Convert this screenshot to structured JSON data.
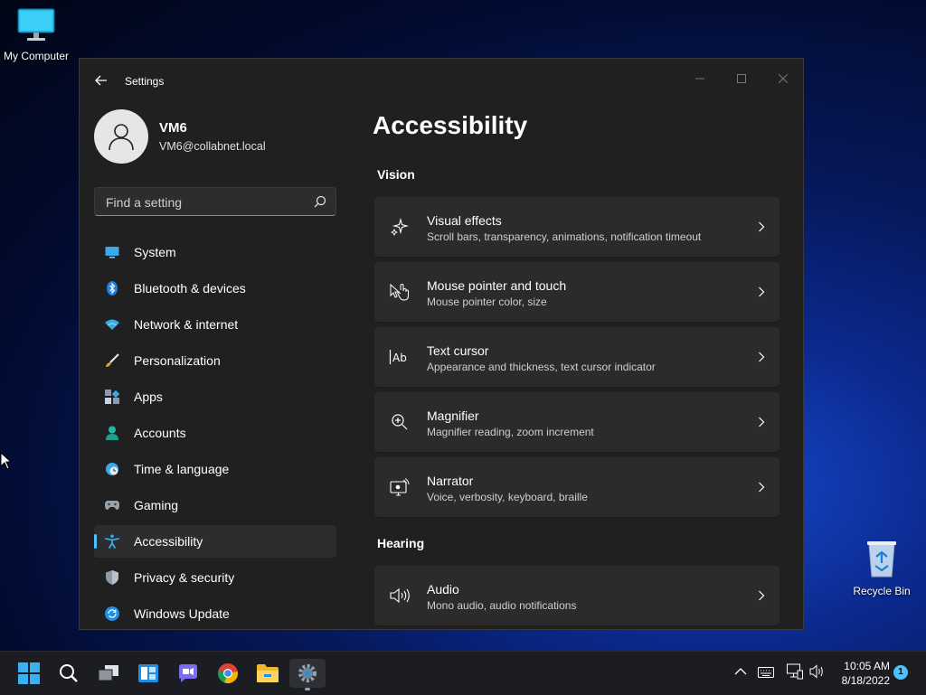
{
  "desktop": {
    "icons": [
      {
        "label": "My Computer"
      },
      {
        "label": "Recycle Bin"
      }
    ]
  },
  "window": {
    "title": "Settings",
    "profile": {
      "name": "VM6",
      "email": "VM6@collabnet.local"
    },
    "search": {
      "placeholder": "Find a setting"
    },
    "nav": [
      {
        "label": "System",
        "icon": "monitor-icon"
      },
      {
        "label": "Bluetooth & devices",
        "icon": "bluetooth-icon"
      },
      {
        "label": "Network & internet",
        "icon": "wifi-icon"
      },
      {
        "label": "Personalization",
        "icon": "brush-icon"
      },
      {
        "label": "Apps",
        "icon": "apps-icon"
      },
      {
        "label": "Accounts",
        "icon": "person-icon"
      },
      {
        "label": "Time & language",
        "icon": "globe-clock-icon"
      },
      {
        "label": "Gaming",
        "icon": "gamepad-icon"
      },
      {
        "label": "Accessibility",
        "icon": "accessibility-icon"
      },
      {
        "label": "Privacy & security",
        "icon": "shield-icon"
      },
      {
        "label": "Windows Update",
        "icon": "update-icon"
      }
    ],
    "active_nav": "Accessibility",
    "page_title": "Accessibility",
    "sections": [
      {
        "title": "Vision",
        "items": [
          {
            "title": "Visual effects",
            "subtitle": "Scroll bars, transparency, animations, notification timeout",
            "icon": "sparkle-icon"
          },
          {
            "title": "Mouse pointer and touch",
            "subtitle": "Mouse pointer color, size",
            "icon": "pointer-touch-icon"
          },
          {
            "title": "Text cursor",
            "subtitle": "Appearance and thickness, text cursor indicator",
            "icon": "text-cursor-icon"
          },
          {
            "title": "Magnifier",
            "subtitle": "Magnifier reading, zoom increment",
            "icon": "magnifier-icon"
          },
          {
            "title": "Narrator",
            "subtitle": "Voice, verbosity, keyboard, braille",
            "icon": "narrator-icon"
          }
        ]
      },
      {
        "title": "Hearing",
        "items": [
          {
            "title": "Audio",
            "subtitle": "Mono audio, audio notifications",
            "icon": "speaker-icon"
          }
        ]
      }
    ]
  },
  "taskbar": {
    "clock": {
      "time": "10:05 AM",
      "date": "8/18/2022"
    },
    "notification_count": "1"
  },
  "colors": {
    "accent": "#4cc2ff",
    "window_bg": "#202020",
    "card_bg": "#2b2b2b"
  }
}
